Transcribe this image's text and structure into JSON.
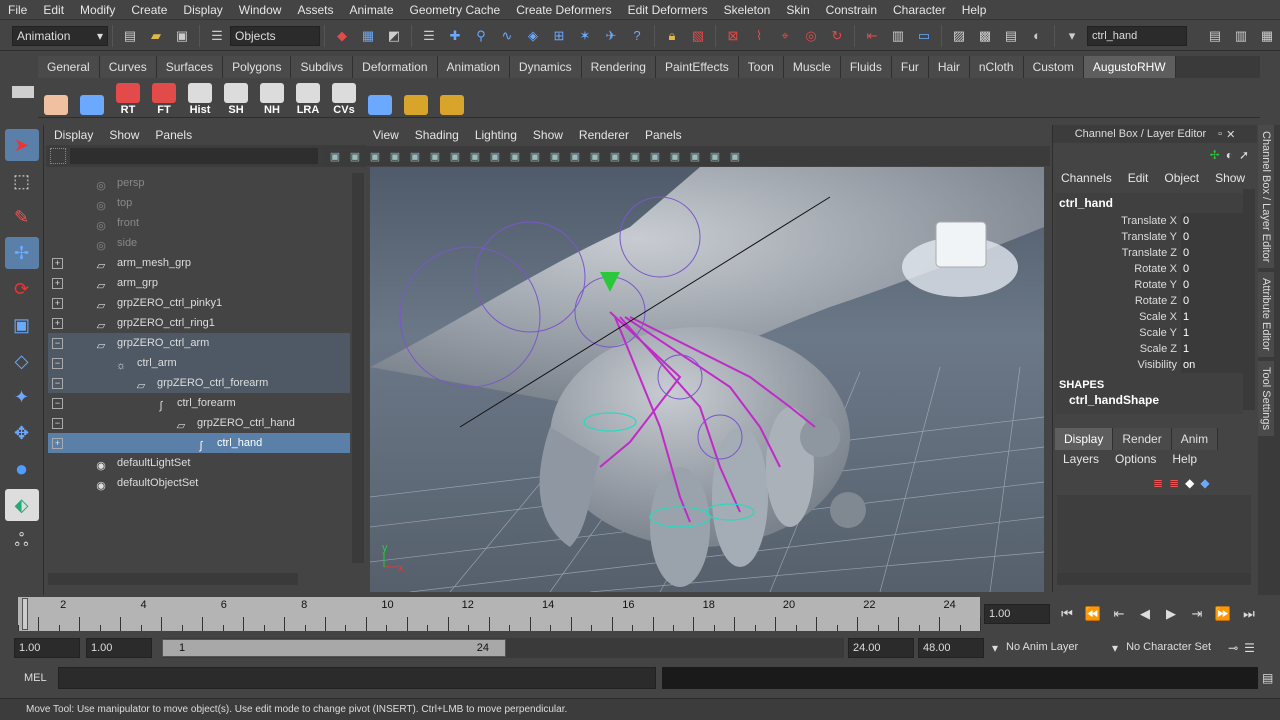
{
  "menubar": [
    "File",
    "Edit",
    "Modify",
    "Create",
    "Display",
    "Window",
    "Assets",
    "Animate",
    "Geometry Cache",
    "Create Deformers",
    "Edit Deformers",
    "Skeleton",
    "Skin",
    "Constrain",
    "Character",
    "Help"
  ],
  "status": {
    "mode": "Animation",
    "select_mode": "Objects",
    "search_value": "ctrl_hand"
  },
  "shelf_tabs": [
    "General",
    "Curves",
    "Surfaces",
    "Polygons",
    "Subdivs",
    "Deformation",
    "Animation",
    "Dynamics",
    "Rendering",
    "PaintEffects",
    "Toon",
    "Muscle",
    "Fluids",
    "Fur",
    "Hair",
    "nCloth",
    "Custom",
    "AugustoRHW"
  ],
  "shelf_active": "AugustoRHW",
  "shelf_buttons": [
    {
      "label": "",
      "icon": "face-icon",
      "color": "#f0c0a0"
    },
    {
      "label": "",
      "icon": "move-pivot-icon",
      "color": "#6aa9ff"
    },
    {
      "label": "RT",
      "icon": "axis-icon",
      "color": "#e34a4a"
    },
    {
      "label": "FT",
      "icon": "axis-icon",
      "color": "#e34a4a"
    },
    {
      "label": "Hist",
      "icon": "history-icon",
      "color": "#dcdcdc"
    },
    {
      "label": "SH",
      "icon": "shape-icon",
      "color": "#dcdcdc"
    },
    {
      "label": "NH",
      "icon": "nohistory-icon",
      "color": "#dcdcdc"
    },
    {
      "label": "LRA",
      "icon": "lra-icon",
      "color": "#dcdcdc"
    },
    {
      "label": "CVs",
      "icon": "cv-icon",
      "color": "#dcdcdc"
    },
    {
      "label": "",
      "icon": "spheres-icon",
      "color": "#6aa9ff"
    },
    {
      "label": "",
      "icon": "globe-icon",
      "color": "#d8a52a"
    },
    {
      "label": "",
      "icon": "cube-icon",
      "color": "#d8a52a"
    }
  ],
  "outliner": {
    "menu": [
      "Display",
      "Show",
      "Panels"
    ],
    "items": [
      {
        "label": "persp",
        "icon": "camera-icon",
        "exp": "",
        "state": "dim",
        "indent": 0
      },
      {
        "label": "top",
        "icon": "camera-icon",
        "exp": "",
        "state": "dim",
        "indent": 0
      },
      {
        "label": "front",
        "icon": "camera-icon",
        "exp": "",
        "state": "dim",
        "indent": 0
      },
      {
        "label": "side",
        "icon": "camera-icon",
        "exp": "",
        "state": "dim",
        "indent": 0
      },
      {
        "label": "arm_mesh_grp",
        "icon": "group-icon",
        "exp": "+",
        "state": "",
        "indent": 0
      },
      {
        "label": "arm_grp",
        "icon": "group-icon",
        "exp": "+",
        "state": "",
        "indent": 0
      },
      {
        "label": "grpZERO_ctrl_pinky1",
        "icon": "group-icon",
        "exp": "+",
        "state": "",
        "indent": 0
      },
      {
        "label": "grpZERO_ctrl_ring1",
        "icon": "group-icon",
        "exp": "+",
        "state": "",
        "indent": 0
      },
      {
        "label": "grpZERO_ctrl_arm",
        "icon": "group-icon",
        "exp": "−",
        "state": "half",
        "indent": 0
      },
      {
        "label": "ctrl_arm",
        "icon": "light-icon",
        "exp": "−",
        "state": "half",
        "indent": 1
      },
      {
        "label": "grpZERO_ctrl_forearm",
        "icon": "group-icon",
        "exp": "−",
        "state": "half",
        "indent": 2
      },
      {
        "label": "ctrl_forearm",
        "icon": "curve-icon",
        "exp": "−",
        "state": "",
        "indent": 3
      },
      {
        "label": "grpZERO_ctrl_hand",
        "icon": "group-icon",
        "exp": "−",
        "state": "",
        "indent": 4
      },
      {
        "label": "ctrl_hand",
        "icon": "curve-icon",
        "exp": "+",
        "state": "sel",
        "indent": 5
      },
      {
        "label": "defaultLightSet",
        "icon": "set-icon",
        "exp": "",
        "state": "",
        "indent": 0
      },
      {
        "label": "defaultObjectSet",
        "icon": "set-icon",
        "exp": "",
        "state": "",
        "indent": 0
      }
    ]
  },
  "viewport_menu": [
    "View",
    "Shading",
    "Lighting",
    "Show",
    "Renderer",
    "Panels"
  ],
  "channel_box": {
    "title": "Channel Box / Layer Editor",
    "menu": [
      "Channels",
      "Edit",
      "Object",
      "Show"
    ],
    "object": "ctrl_hand",
    "channels": [
      {
        "name": "Translate X",
        "value": "0"
      },
      {
        "name": "Translate Y",
        "value": "0"
      },
      {
        "name": "Translate Z",
        "value": "0"
      },
      {
        "name": "Rotate X",
        "value": "0"
      },
      {
        "name": "Rotate Y",
        "value": "0"
      },
      {
        "name": "Rotate Z",
        "value": "0"
      },
      {
        "name": "Scale X",
        "value": "1"
      },
      {
        "name": "Scale Y",
        "value": "1"
      },
      {
        "name": "Scale Z",
        "value": "1"
      },
      {
        "name": "Visibility",
        "value": "on"
      }
    ],
    "shapes_label": "SHAPES",
    "shape_name": "ctrl_handShape",
    "layer_tabs": [
      "Display",
      "Render",
      "Anim"
    ],
    "layer_menu": [
      "Layers",
      "Options",
      "Help"
    ]
  },
  "side_tabs": [
    "Channel Box / Layer Editor",
    "Attribute Editor",
    "Tool Settings"
  ],
  "timeline": {
    "labels": [
      "2",
      "4",
      "6",
      "8",
      "10",
      "12",
      "14",
      "16",
      "18",
      "20",
      "22",
      "24"
    ],
    "current_frame": "1.00"
  },
  "range": {
    "start": "1.00",
    "playback_start": "1.00",
    "slider_start": "1",
    "slider_end": "24",
    "playback_end": "24.00",
    "end": "48.00",
    "anim_layer": "No Anim Layer",
    "character_set": "No Character Set"
  },
  "mel": {
    "label": "MEL"
  },
  "help_line": "Move Tool: Use manipulator to move object(s). Use edit mode to change pivot (INSERT).  Ctrl+LMB to move perpendicular."
}
